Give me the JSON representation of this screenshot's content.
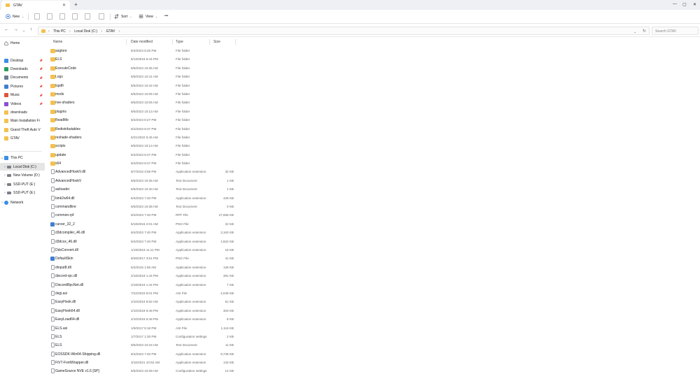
{
  "window": {
    "tab_title": "GTAV",
    "tab_close": "✕",
    "new_tab": "+",
    "minimize": "—",
    "maximize": "▢",
    "close": "✕"
  },
  "toolbar": {
    "new_label": "New",
    "sort_label": "Sort",
    "view_label": "View",
    "more_label": "•••"
  },
  "address": {
    "crumbs": [
      "This PC",
      "Local Disk (C:)",
      "GTAV"
    ],
    "search_placeholder": "Search GTAV"
  },
  "sidebar": {
    "home": "Home",
    "quick": [
      {
        "label": "Desktop",
        "pinned": true,
        "color": "#3a8ee6"
      },
      {
        "label": "Downloads",
        "pinned": true,
        "color": "#2a9d5c"
      },
      {
        "label": "Documents",
        "pinned": true,
        "color": "#6b7c93"
      },
      {
        "label": "Pictures",
        "pinned": true,
        "color": "#3f7fd1"
      },
      {
        "label": "Music",
        "pinned": true,
        "color": "#e0533b"
      },
      {
        "label": "Videos",
        "pinned": true,
        "color": "#8a4fd1"
      },
      {
        "label": "downloads",
        "pinned": false,
        "color": "#f3c14f"
      },
      {
        "label": "Main Installation Fi",
        "pinned": false,
        "color": "#f3c14f"
      },
      {
        "label": "Grand Theft Auto V",
        "pinned": false,
        "color": "#f3c14f"
      },
      {
        "label": "GTAV",
        "pinned": false,
        "color": "#f3c14f"
      }
    ],
    "this_pc": "This PC",
    "drives": [
      {
        "label": "Local Disk (C:)",
        "selected": true
      },
      {
        "label": "New Volume (D:)",
        "selected": false
      },
      {
        "label": "SSD-PUT (E:)",
        "selected": false
      },
      {
        "label": "SSD-PUT (E:)",
        "selected": false
      }
    ],
    "network": "Network"
  },
  "columns": {
    "name": "Name",
    "date": "Date modified",
    "type": "Type",
    "size": "Size"
  },
  "files": [
    {
      "name": "asgtore",
      "date": "8/4/2023 8:25 PM",
      "type": "File folder",
      "size": "",
      "kind": "folder"
    },
    {
      "name": "ELS",
      "date": "5/13/2016 5:44 PM",
      "type": "File folder",
      "size": "",
      "kind": "folder"
    },
    {
      "name": "ExecuteCode",
      "date": "8/5/2023 10:35 AM",
      "type": "File folder",
      "size": "",
      "kind": "folder"
    },
    {
      "name": "Logs",
      "date": "8/5/2023 10:41 AM",
      "type": "File folder",
      "size": "",
      "kind": "folder"
    },
    {
      "name": "lspdfr",
      "date": "8/5/2023 10:42 AM",
      "type": "File folder",
      "size": "",
      "kind": "folder"
    },
    {
      "name": "mods",
      "date": "8/5/2023 10:05 AM",
      "type": "File folder",
      "size": "",
      "kind": "folder"
    },
    {
      "name": "nve-shaders",
      "date": "8/5/2023 10:05 AM",
      "type": "File folder",
      "size": "",
      "kind": "folder"
    },
    {
      "name": "plugins",
      "date": "8/5/2023 10:13 AM",
      "type": "File folder",
      "size": "",
      "kind": "folder"
    },
    {
      "name": "ReadMe",
      "date": "8/4/2023 8:27 PM",
      "type": "File folder",
      "size": "",
      "kind": "folder"
    },
    {
      "name": "Redistributables",
      "date": "8/4/2023 8:27 PM",
      "type": "File folder",
      "size": "",
      "kind": "folder"
    },
    {
      "name": "reshade-shaders",
      "date": "5/21/2022 6:45 AM",
      "type": "File folder",
      "size": "",
      "kind": "folder"
    },
    {
      "name": "scripts",
      "date": "8/5/2023 10:13 AM",
      "type": "File folder",
      "size": "",
      "kind": "folder"
    },
    {
      "name": "update",
      "date": "8/4/2023 8:27 PM",
      "type": "File folder",
      "size": "",
      "kind": "folder"
    },
    {
      "name": "x64",
      "date": "8/4/2023 8:27 PM",
      "type": "File folder",
      "size": "",
      "kind": "folder"
    },
    {
      "name": "AdvancedHookV.dll",
      "date": "8/7/2016 3:58 PM",
      "type": "Application extension",
      "size": "32 KB",
      "kind": "file"
    },
    {
      "name": "AdvancedHookV",
      "date": "8/5/2023 10:36 AM",
      "type": "Text Document",
      "size": "1 KB",
      "kind": "file"
    },
    {
      "name": "asiloader",
      "date": "8/5/2023 10:40 AM",
      "type": "Text Document",
      "size": "1 KB",
      "kind": "file"
    },
    {
      "name": "bink2w64.dll",
      "date": "8/4/2023 7:40 PM",
      "type": "Application extension",
      "size": "426 KB",
      "kind": "file"
    },
    {
      "name": "commandline",
      "date": "8/5/2023 10:38 AM",
      "type": "Text Document",
      "size": "0 KB",
      "kind": "file"
    },
    {
      "name": "common.rpf",
      "date": "8/4/2023 7:40 PM",
      "type": "RPF File",
      "size": "27,656 KB",
      "kind": "file"
    },
    {
      "name": "cursor_32_2",
      "date": "5/18/2015 2:01 AM",
      "type": "PNG File",
      "size": "22 KB",
      "kind": "image"
    },
    {
      "name": "d3dcompiler_46.dll",
      "date": "8/4/2023 7:40 PM",
      "type": "Application extension",
      "size": "3,163 KB",
      "kind": "file"
    },
    {
      "name": "d3dcsx_46.dll",
      "date": "8/4/2023 7:40 PM",
      "type": "Application extension",
      "size": "1,822 KB",
      "kind": "file"
    },
    {
      "name": "DdsConvert.dll",
      "date": "1/19/2019 11:11 PM",
      "type": "Application extension",
      "size": "15 KB",
      "kind": "file"
    },
    {
      "name": "DefaultSkin",
      "date": "8/26/2017 3:51 PM",
      "type": "PNG File",
      "size": "41 KB",
      "kind": "image"
    },
    {
      "name": "dinput8.dll",
      "date": "5/2/2015 1:55 AM",
      "type": "Application extension",
      "size": "128 KB",
      "kind": "file"
    },
    {
      "name": "discord-rpc.dll",
      "date": "2/18/2019 1:44 PM",
      "type": "Application extension",
      "size": "391 KB",
      "kind": "file"
    },
    {
      "name": "DiscordRpcNet.dll",
      "date": "2/18/2019 1:44 PM",
      "type": "Application extension",
      "size": "7 KB",
      "kind": "file"
    },
    {
      "name": "dxgi.asi",
      "date": "7/22/2023 8:01 PM",
      "type": "ASI File",
      "size": "4,045 KB",
      "kind": "file"
    },
    {
      "name": "EasyHook.dll",
      "date": "2/10/2018 8:52 AM",
      "type": "Application extension",
      "size": "51 KB",
      "kind": "file"
    },
    {
      "name": "EasyHook64.dll",
      "date": "2/10/2018 6:48 PM",
      "type": "Application extension",
      "size": "303 KB",
      "kind": "file"
    },
    {
      "name": "EasyLoad64.dll",
      "date": "2/10/2018 6:48 PM",
      "type": "Application extension",
      "size": "8 KB",
      "kind": "file"
    },
    {
      "name": "ELS.asi",
      "date": "1/9/2017 5:18 PM",
      "type": "ASI File",
      "size": "1,116 KB",
      "kind": "file"
    },
    {
      "name": "ELS",
      "date": "1/7/2017 1:30 PM",
      "type": "Configuration settings",
      "size": "2 KB",
      "kind": "file"
    },
    {
      "name": "ELS",
      "date": "8/5/2023 10:16 AM",
      "type": "Text Document",
      "size": "11 KB",
      "kind": "file"
    },
    {
      "name": "EOSSDK-Win64-Shipping.dll",
      "date": "8/4/2023 7:40 PM",
      "type": "Application extension",
      "size": "9,739 KB",
      "kind": "file"
    },
    {
      "name": "FiVT-FontWrapper.dll",
      "date": "3/16/2021 10:52 AM",
      "type": "Application extension",
      "size": "133 KB",
      "kind": "file"
    },
    {
      "name": "GameSource NVE v1.6 [SP]",
      "date": "8/5/2023 10:39 AM",
      "type": "Configuration settings",
      "size": "14 KB",
      "kind": "file"
    }
  ]
}
